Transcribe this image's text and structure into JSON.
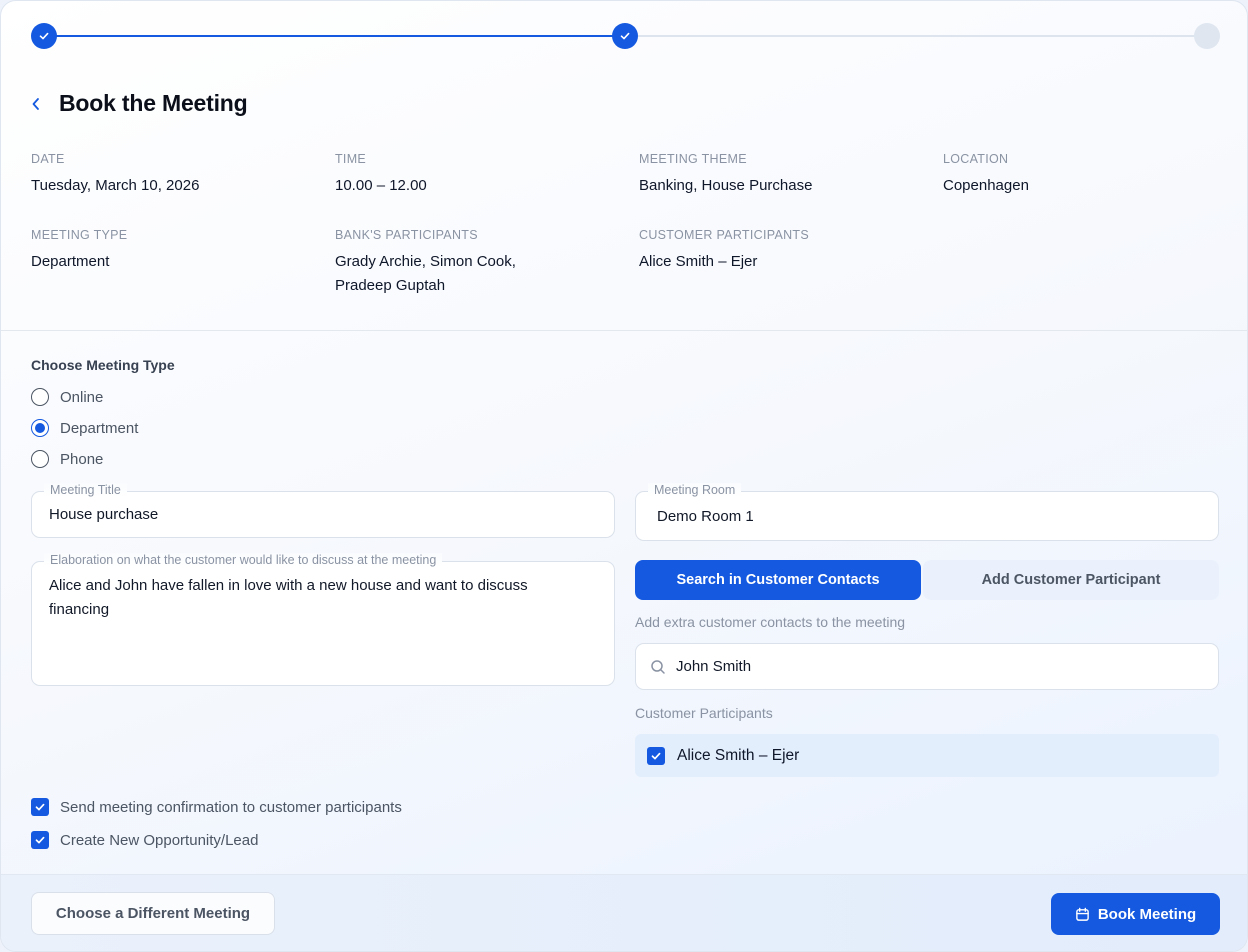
{
  "page": {
    "title": "Book the Meeting"
  },
  "stepper": {
    "steps": [
      "complete",
      "complete",
      "incomplete"
    ]
  },
  "summary": {
    "date": {
      "label": "DATE",
      "value": "Tuesday, March 10, 2026"
    },
    "time": {
      "label": "TIME",
      "value": "10.00 – 12.00"
    },
    "theme": {
      "label": "MEETING THEME",
      "value": "Banking, House Purchase"
    },
    "location": {
      "label": "LOCATION",
      "value": "Copenhagen"
    },
    "type": {
      "label": "MEETING TYPE",
      "value": "Department"
    },
    "bank_participants": {
      "label": "BANK'S PARTICIPANTS",
      "line1": "Grady Archie, Simon Cook,",
      "line2": "Pradeep Guptah"
    },
    "customer_participants": {
      "label": "CUSTOMER PARTICIPANTS",
      "value": "Alice Smith – Ejer"
    }
  },
  "meeting_type": {
    "label": "Choose Meeting Type",
    "options": [
      "Online",
      "Department",
      "Phone"
    ],
    "selected": "Department"
  },
  "form": {
    "title": {
      "label": "Meeting Title",
      "value": "House purchase"
    },
    "room": {
      "label": "Meeting Room",
      "value": "Demo Room 1"
    },
    "elaboration": {
      "label": "Elaboration on what the customer would like to discuss at the meeting",
      "line1": "Alice and John have fallen in love with a new house and want to discuss",
      "line2": "financing"
    }
  },
  "tabs": {
    "search": "Search in Customer Contacts",
    "add": "Add Customer Participant"
  },
  "contacts": {
    "helper": "Add extra customer contacts to the meeting",
    "search_value": "John Smith",
    "participants_label": "Customer Participants",
    "participants": [
      "Alice Smith – Ejer"
    ]
  },
  "options": {
    "send_confirmation": "Send meeting confirmation to customer participants",
    "create_opportunity": "Create New Opportunity/Lead"
  },
  "footer": {
    "secondary": "Choose a Different Meeting",
    "primary": "Book Meeting"
  },
  "colors": {
    "accent": "#1459e0",
    "muted": "#8a93a3"
  },
  "icons": [
    "check-icon",
    "chevron-left-icon",
    "search-icon",
    "calendar-icon"
  ]
}
